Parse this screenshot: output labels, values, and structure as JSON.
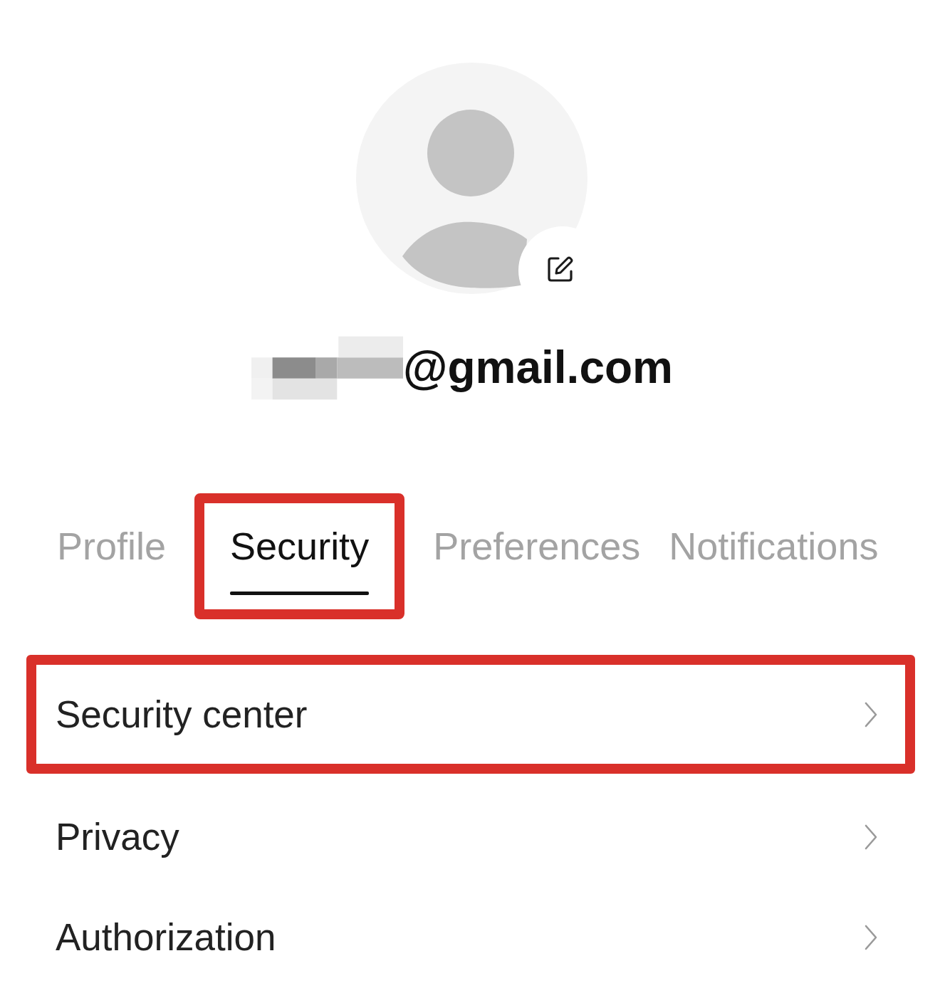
{
  "email": {
    "text": "@gmail.com",
    "redacted": true
  },
  "tabs": [
    {
      "label": "Profile",
      "selected": false,
      "highlighted": false
    },
    {
      "label": "Security",
      "selected": true,
      "highlighted": true
    },
    {
      "label": "Preferences",
      "selected": false,
      "highlighted": false
    },
    {
      "label": "Notifications",
      "selected": false,
      "highlighted": false
    }
  ],
  "rows": [
    {
      "label": "Security center",
      "highlighted": true
    },
    {
      "label": "Privacy",
      "highlighted": false
    },
    {
      "label": "Authorization",
      "highlighted": false
    }
  ]
}
